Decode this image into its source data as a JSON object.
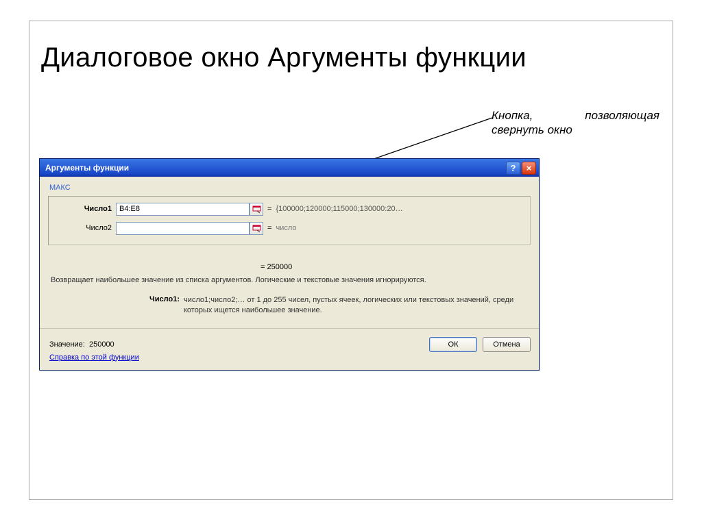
{
  "slide": {
    "title": "Диалоговое окно Аргументы функции"
  },
  "callout": {
    "line1": "Кнопка, позволяющая",
    "line2": "свернуть окно"
  },
  "dialog": {
    "title": "Аргументы функции",
    "help_glyph": "?",
    "close_glyph": "×",
    "function_name": "МАКС",
    "args": [
      {
        "label": "Число1",
        "value": "B4:E8",
        "result": "{100000;120000;115000;130000:20…",
        "bold": true
      },
      {
        "label": "Число2",
        "value": "",
        "result": "число",
        "bold": false
      }
    ],
    "formula_result_prefix": "= ",
    "formula_result": "250000",
    "description": "Возвращает наибольшее значение из списка аргументов. Логические и текстовые значения игнорируются.",
    "arg_help": {
      "label": "Число1:",
      "text": "число1;число2;… от 1 до 255 чисел, пустых ячеек, логических или текстовых значений, среди которых ищется наибольшее значение."
    },
    "value_label": "Значение:",
    "value": "250000",
    "help_link": "Справка по этой функции",
    "ok": "ОК",
    "cancel": "Отмена"
  }
}
